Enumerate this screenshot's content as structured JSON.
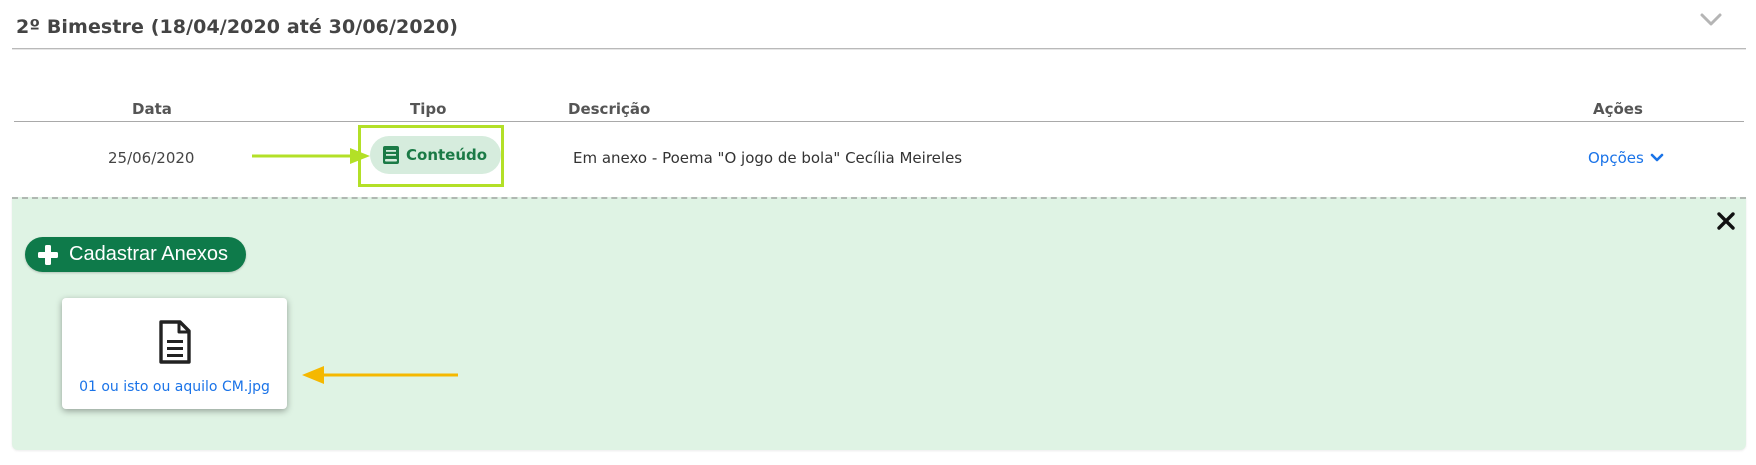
{
  "section": {
    "title": "2º Bimestre (18/04/2020 até 30/06/2020)",
    "collapse_icon": "chevron-down-icon"
  },
  "table": {
    "headers": {
      "data": "Data",
      "tipo": "Tipo",
      "descricao": "Descrição",
      "acoes": "Ações"
    },
    "rows": [
      {
        "data": "25/06/2020",
        "tipo": "Conteúdo",
        "tipo_icon": "book-icon",
        "descricao": "Em anexo - Poema \"O jogo de bola\" Cecília Meireles",
        "acoes_label": "Opções",
        "acoes_icon": "chevron-down-icon"
      }
    ]
  },
  "attachments_panel": {
    "add_button_label": "Cadastrar Anexos",
    "add_button_icon": "plus-icon",
    "close_icon": "close-icon",
    "files": [
      {
        "name": "01 ou isto ou aquilo CM.jpg",
        "icon": "file-text-icon"
      }
    ]
  },
  "annotations": {
    "green_arrow_color": "#b3e027",
    "yellow_arrow_color": "#f5b800",
    "highlight_color": "#b3e027"
  },
  "colors": {
    "accent_green": "#0e7a4a",
    "panel_background": "#dff3e4",
    "badge_background": "#d6ecdd",
    "link_blue": "#1a73e8"
  }
}
